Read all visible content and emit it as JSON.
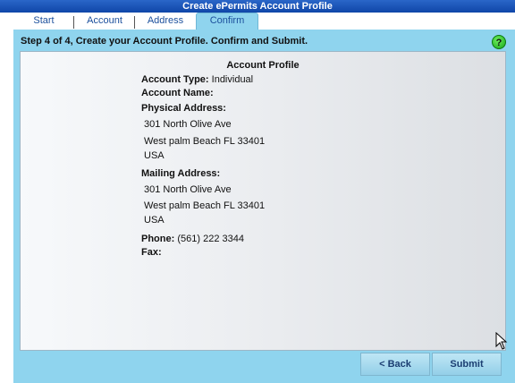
{
  "window": {
    "title": "Create ePermits Account Profile"
  },
  "tabs": [
    {
      "label": "Start"
    },
    {
      "label": "Account"
    },
    {
      "label": "Address"
    },
    {
      "label": "Confirm"
    }
  ],
  "header": {
    "step_text": "Step 4 of 4, Create your Account Profile. Confirm and Submit.",
    "help_label": "?"
  },
  "profile": {
    "title": "Account Profile",
    "account_type_label": "Account Type:",
    "account_type_value": "Individual",
    "account_name_label": "Account Name:",
    "account_name_value": "",
    "physical_label": "Physical Address:",
    "physical_lines": [
      "301 North Olive Ave",
      "West palm Beach FL 33401",
      "USA"
    ],
    "mailing_label": "Mailing Address:",
    "mailing_lines": [
      "301 North Olive Ave",
      "West palm Beach FL 33401",
      "USA"
    ],
    "phone_label": "Phone:",
    "phone_value": "(561) 222 3344",
    "fax_label": "Fax:",
    "fax_value": ""
  },
  "buttons": {
    "back": "<  Back",
    "submit": "Submit"
  },
  "colors": {
    "panel": "#8fd4ee",
    "titlebar": "#1f58b8",
    "help": "#22b522"
  }
}
